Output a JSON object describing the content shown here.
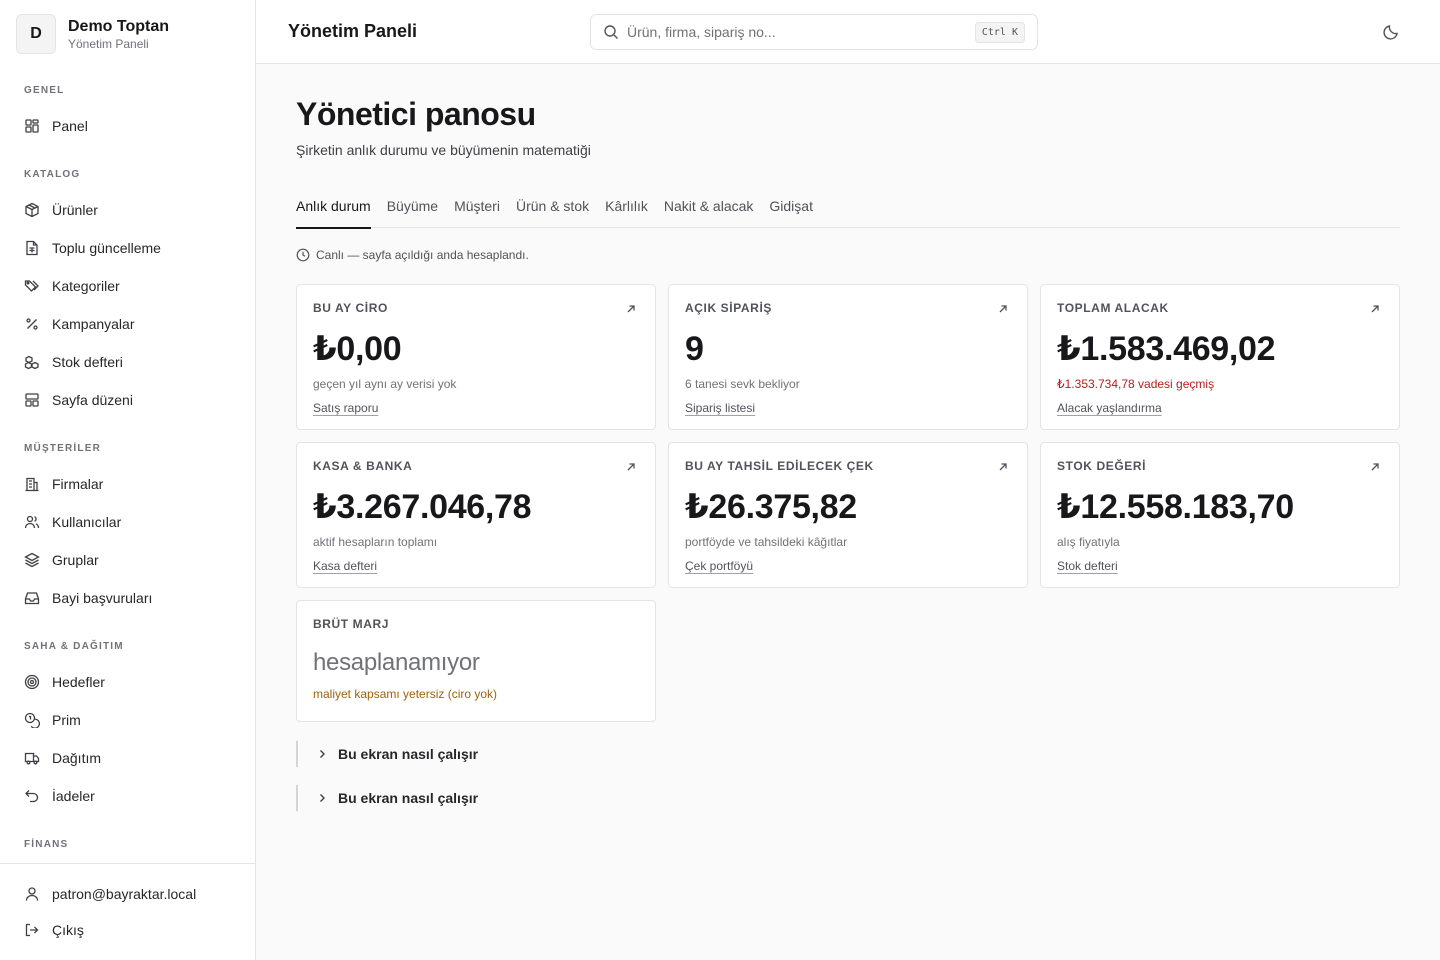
{
  "brand": {
    "initial": "D",
    "name": "Demo Toptan",
    "subtitle": "Yönetim Paneli"
  },
  "sidebar": {
    "sections": [
      {
        "title": "GENEL",
        "items": [
          {
            "label": "Panel",
            "icon": "grid-icon"
          }
        ]
      },
      {
        "title": "KATALOG",
        "items": [
          {
            "label": "Ürünler",
            "icon": "package-icon"
          },
          {
            "label": "Toplu güncelleme",
            "icon": "file-spreadsheet-icon"
          },
          {
            "label": "Kategoriler",
            "icon": "tags-icon"
          },
          {
            "label": "Kampanyalar",
            "icon": "percent-icon"
          },
          {
            "label": "Stok defteri",
            "icon": "boxes-icon"
          },
          {
            "label": "Sayfa düzeni",
            "icon": "layout-icon"
          }
        ]
      },
      {
        "title": "MÜŞTERİLER",
        "items": [
          {
            "label": "Firmalar",
            "icon": "building-icon"
          },
          {
            "label": "Kullanıcılar",
            "icon": "users-icon"
          },
          {
            "label": "Gruplar",
            "icon": "layers-icon"
          },
          {
            "label": "Bayi başvuruları",
            "icon": "inbox-icon"
          }
        ]
      },
      {
        "title": "SAHA & DAĞITIM",
        "items": [
          {
            "label": "Hedefler",
            "icon": "target-icon"
          },
          {
            "label": "Prim",
            "icon": "coins-icon"
          },
          {
            "label": "Dağıtım",
            "icon": "truck-icon"
          },
          {
            "label": "İadeler",
            "icon": "undo-icon"
          }
        ]
      },
      {
        "title": "FİNANS",
        "items": []
      }
    ],
    "footer": {
      "user": "patron@bayraktar.local",
      "logout": "Çıkış"
    }
  },
  "header": {
    "title": "Yönetim Paneli",
    "search_placeholder": "Ürün, firma, sipariş no...",
    "shortcut": "Ctrl K"
  },
  "page": {
    "title": "Yönetici panosu",
    "subtitle": "Şirketin anlık durumu ve büyümenin matematiği",
    "tabs": [
      "Anlık durum",
      "Büyüme",
      "Müşteri",
      "Ürün & stok",
      "Kârlılık",
      "Nakit & alacak",
      "Gidişat"
    ],
    "active_tab": "Anlık durum",
    "live_note": "Canlı — sayfa açıldığı anda hesaplandı."
  },
  "cards": [
    {
      "label": "BU AY CİRO",
      "value": "₺0,00",
      "note": "geçen yıl aynı ay verisi yok",
      "note_style": "muted",
      "link": "Satış raporu"
    },
    {
      "label": "AÇIK SİPARİŞ",
      "value": "9",
      "note": "6 tanesi sevk bekliyor",
      "note_style": "muted",
      "link": "Sipariş listesi"
    },
    {
      "label": "TOPLAM ALACAK",
      "value": "₺1.583.469,02",
      "note": "₺1.353.734,78 vadesi geçmiş",
      "note_style": "red",
      "link": "Alacak yaşlandırma"
    },
    {
      "label": "KASA & BANKA",
      "value": "₺3.267.046,78",
      "note": "aktif hesapların toplamı",
      "note_style": "muted",
      "link": "Kasa defteri"
    },
    {
      "label": "BU AY TAHSİL EDİLECEK ÇEK",
      "value": "₺26.375,82",
      "note": "portföyde ve tahsildeki kâğıtlar",
      "note_style": "muted",
      "link": "Çek portföyü"
    },
    {
      "label": "STOK DEĞERİ",
      "value": "₺12.558.183,70",
      "note": "alış fiyatıyla",
      "note_style": "muted",
      "link": "Stok defteri"
    },
    {
      "label": "BRÜT MARJ",
      "value": "hesaplanamıyor",
      "note": "maliyet kapsamı yetersiz (ciro yok)",
      "note_style": "amber",
      "link": ""
    }
  ],
  "help": [
    "Bu ekran nasıl çalışır",
    "Bu ekran nasıl çalışır"
  ]
}
